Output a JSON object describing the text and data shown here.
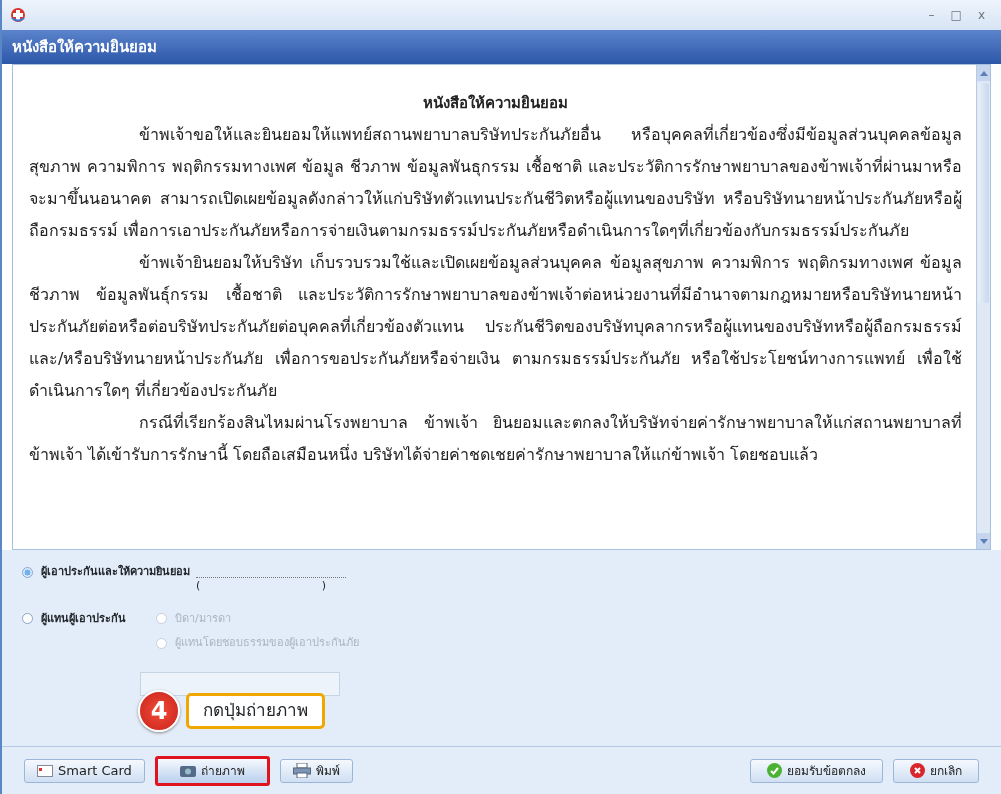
{
  "window": {
    "title": "หนังสือให้ความยินยอม",
    "controls": [
      "–",
      "□",
      "x"
    ]
  },
  "document": {
    "heading": "หนังสือให้ความยินยอม",
    "paragraphs": [
      "ข้าพเจ้าขอให้และยินยอมให้แพทย์สถานพยาบาลบริษัทประกันภัยอื่น หรือบุคคลที่เกี่ยวข้องซึ่งมีข้อมูลส่วนบุคคลข้อมูลสุขภาพ ความพิการ พฤติกรรมทางเพศ ข้อมูล ชีวภาพ ข้อมูลพันธุกรรม เชื้อชาติ และประวัติการรักษาพยาบาลของข้าพเจ้าที่ผ่านมาหรือจะมาขึ้นนอนาคต สามารถเปิดเผยข้อมูลดังกล่าวให้แก่บริษัทตัวแทนประกันชีวิตหรือผู้แทนของบริษัท หรือบริษัทนายหน้าประกันภัยหรือผู้ถือกรมธรรม์ เพื่อการเอาประกันภัยหรือการจ่ายเงินตามกรมธรรม์ประกันภัยหรือดำเนินการใดๆที่เกี่ยวข้องกับกรมธรรม์ประกันภัย",
      "ข้าพเจ้ายินยอมให้บริษัท เก็บรวบรวมใช้และเปิดเผยข้อมูลส่วนบุคคล ข้อมูลสุขภาพ ความพิการ พฤติกรมทางเพศ ข้อมูลชีวภาพ ข้อมูลพันธุ์กรรม เชื้อชาติ และประวัติการรักษาพยาบาลของข้าพเจ้าต่อหน่วยงานที่มีอำนาจตามกฎหมายหรือบริษัทนายหน้าประกันภัยต่อหรือต่อบริษัทประกันภัยต่อบุคคลที่เกี่ยวข้องตัวแทน ประกันชีวิตของบริษัทบุคลากรหรือผู้แทนของบริษัทหรือผู้ถือกรมธรรม์ และ/หรือบริษัทนายหน้าประกันภัย เพื่อการขอประกันภัยหรือจ่ายเงิน ตามกรมธรรม์ประกันภัย หรือใช้ประโยชน์ทางการแพทย์ เพื่อใช้ดำเนินการใดๆ ที่เกี่ยวข้องประกันภัย",
      "กรณีที่เรียกร้องสินไหมผ่านโรงพยาบาล ข้าพเจ้า ยินยอมและตกลงให้บริษัทจ่ายค่ารักษาพยาบาลให้แก่สถานพยาบาลที่ข้าพเจ้า ได้เข้ารับการรักษานี้ โดยถือเสมือนหนึ่ง บริษัทได้จ่ายค่าชดเชยค่ารักษาพยาบาลให้แก่ข้าพเจ้า โดยชอบแล้ว"
    ]
  },
  "consent_options": [
    {
      "label": "ผู้เอาประกันและให้ความยินยอม",
      "selected": true
    },
    {
      "label": "ผู้แทนผู้เอาประกัน",
      "selected": false,
      "sub_options": [
        {
          "label": "บิดา/มารดา",
          "selected": false,
          "disabled": true
        },
        {
          "label": "ผู้แทนโดยชอบธรรมของผู้เอาประกันภัย",
          "selected": false,
          "disabled": true
        }
      ]
    }
  ],
  "signature": {
    "open": "(",
    "close": ")"
  },
  "callout": {
    "step": "4",
    "text": "กดปุ่มถ่ายภาพ"
  },
  "buttons_left": [
    {
      "kind": "card",
      "label": "Smart Card",
      "highlighted": false
    },
    {
      "kind": "camera",
      "label": "ถ่ายภาพ",
      "highlighted": true
    },
    {
      "kind": "print",
      "label": "พิมพ์",
      "highlighted": false
    }
  ],
  "buttons_right": [
    {
      "kind": "ok",
      "label": "ยอมรับข้อตกลง"
    },
    {
      "kind": "cancel",
      "label": "ยกเลิก"
    }
  ]
}
